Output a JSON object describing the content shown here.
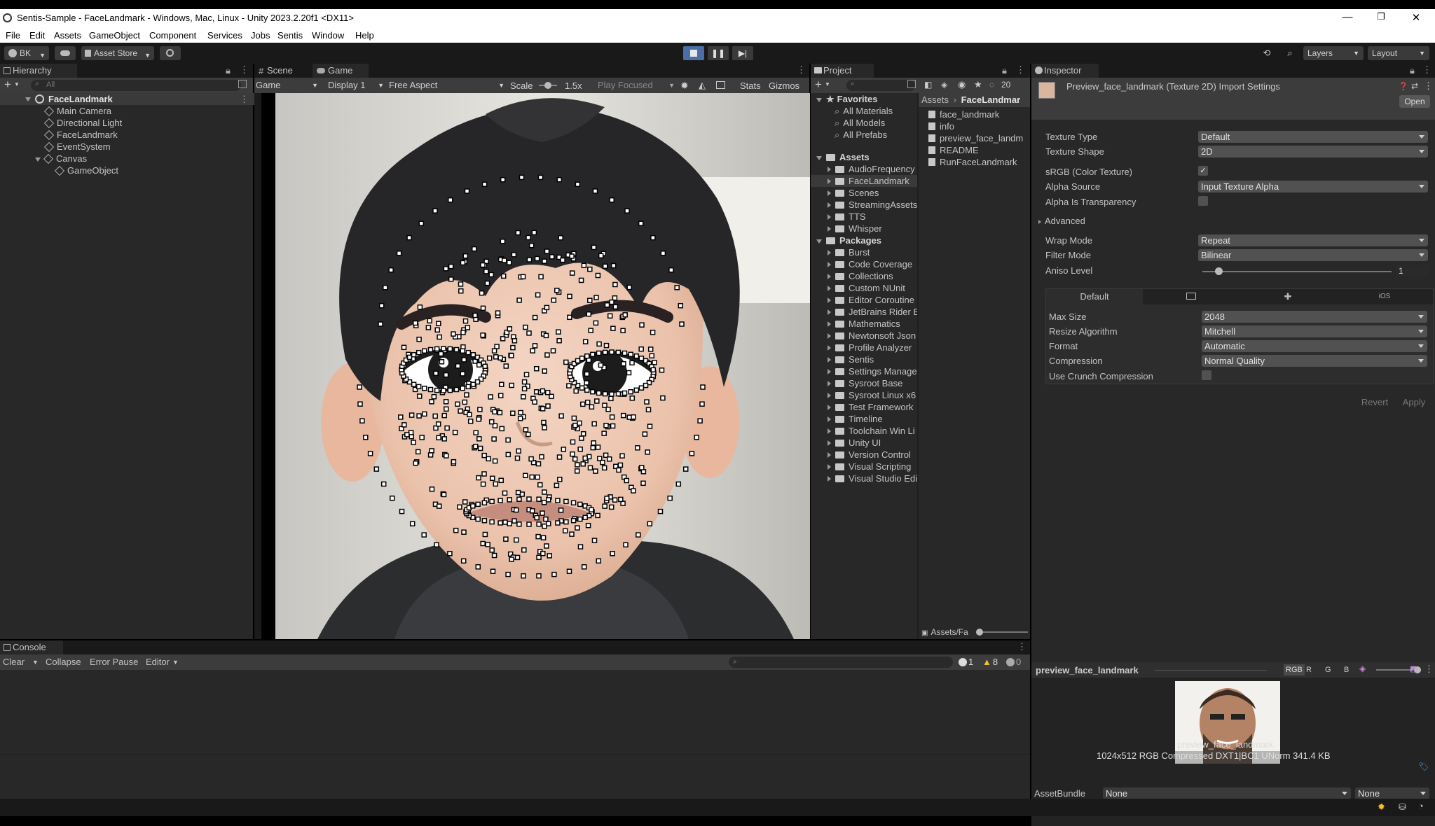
{
  "window": {
    "title": "Sentis-Sample - FaceLandmark - Windows, Mac, Linux - Unity 2023.2.20f1 <DX11>",
    "minimize": "—",
    "maximize": "❐",
    "close": "✕"
  },
  "menu": [
    "File",
    "Edit",
    "Assets",
    "GameObject",
    "Component",
    "Services",
    "Jobs",
    "Sentis",
    "Window",
    "Help"
  ],
  "toolbar": {
    "account": "BK",
    "asset_store": "Asset Store",
    "layers": "Layers",
    "layout": "Layout"
  },
  "hierarchy": {
    "tab": "Hierarchy",
    "search_placeholder": "All",
    "items": [
      "FaceLandmark",
      "Main Camera",
      "Directional Light",
      "FaceLandmark",
      "EventSystem",
      "Canvas",
      "GameObject"
    ]
  },
  "game": {
    "tab_scene": "Scene",
    "tab_game": "Game",
    "mode": "Game",
    "display": "Display 1",
    "aspect": "Free Aspect",
    "scale_label": "Scale",
    "scale_value": "1.5x",
    "play_focused": "Play Focused",
    "stats": "Stats",
    "gizmos": "Gizmos"
  },
  "project": {
    "tab": "Project",
    "visible_count": "20",
    "favorites_label": "Favorites",
    "favorites": [
      "All Materials",
      "All Models",
      "All Prefabs"
    ],
    "assets_label": "Assets",
    "asset_folders": [
      "AudioFrequency",
      "FaceLandmark",
      "Scenes",
      "StreamingAssets",
      "TTS",
      "Whisper"
    ],
    "packages_label": "Packages",
    "packages": [
      "Burst",
      "Code Coverage",
      "Collections",
      "Custom NUnit",
      "Editor Coroutine",
      "JetBrains Rider E",
      "Mathematics",
      "Newtonsoft Json",
      "Profile Analyzer",
      "Sentis",
      "Settings Manage",
      "Sysroot Base",
      "Sysroot Linux x6",
      "Test Framework",
      "Timeline",
      "Toolchain Win Li",
      "Unity UI",
      "Version Control",
      "Visual Scripting",
      "Visual Studio Edi"
    ],
    "breadcrumb_root": "Assets",
    "breadcrumb_current": "FaceLandmar",
    "files": [
      "face_landmark",
      "info",
      "preview_face_landm",
      "README",
      "RunFaceLandmark"
    ],
    "footer_path": "Assets/Fa"
  },
  "inspector": {
    "tab": "Inspector",
    "title": "Preview_face_landmark (Texture 2D) Import Settings",
    "open_button": "Open",
    "texture_type_label": "Texture Type",
    "texture_type": "Default",
    "texture_shape_label": "Texture Shape",
    "texture_shape": "2D",
    "srgb_label": "sRGB (Color Texture)",
    "alpha_source_label": "Alpha Source",
    "alpha_source": "Input Texture Alpha",
    "alpha_transparency_label": "Alpha Is Transparency",
    "advanced_label": "Advanced",
    "wrap_mode_label": "Wrap Mode",
    "wrap_mode": "Repeat",
    "filter_mode_label": "Filter Mode",
    "filter_mode": "Bilinear",
    "aniso_label": "Aniso Level",
    "aniso_value": "1",
    "platform_default": "Default",
    "platform_ios": "iOS",
    "max_size_label": "Max Size",
    "max_size": "2048",
    "resize_label": "Resize Algorithm",
    "resize": "Mitchell",
    "format_label": "Format",
    "format": "Automatic",
    "compression_label": "Compression",
    "compression": "Normal Quality",
    "crunch_label": "Use Crunch Compression",
    "revert": "Revert",
    "apply": "Apply",
    "preview_name": "preview_face_landmark",
    "channels": [
      "RGB",
      "R",
      "G",
      "B"
    ],
    "preview_overlay": "preview_face_landmark",
    "preview_info": "1024x512  RGB Compressed DXT1|BC1 UNorm  341.4 KB",
    "assetbundle_label": "AssetBundle",
    "assetbundle_value": "None",
    "assetbundle_variant": "None"
  },
  "console": {
    "tab": "Console",
    "clear": "Clear",
    "collapse": "Collapse",
    "error_pause": "Error Pause",
    "editor": "Editor",
    "info_count": "1",
    "warn_count": "8",
    "error_count": "0"
  }
}
